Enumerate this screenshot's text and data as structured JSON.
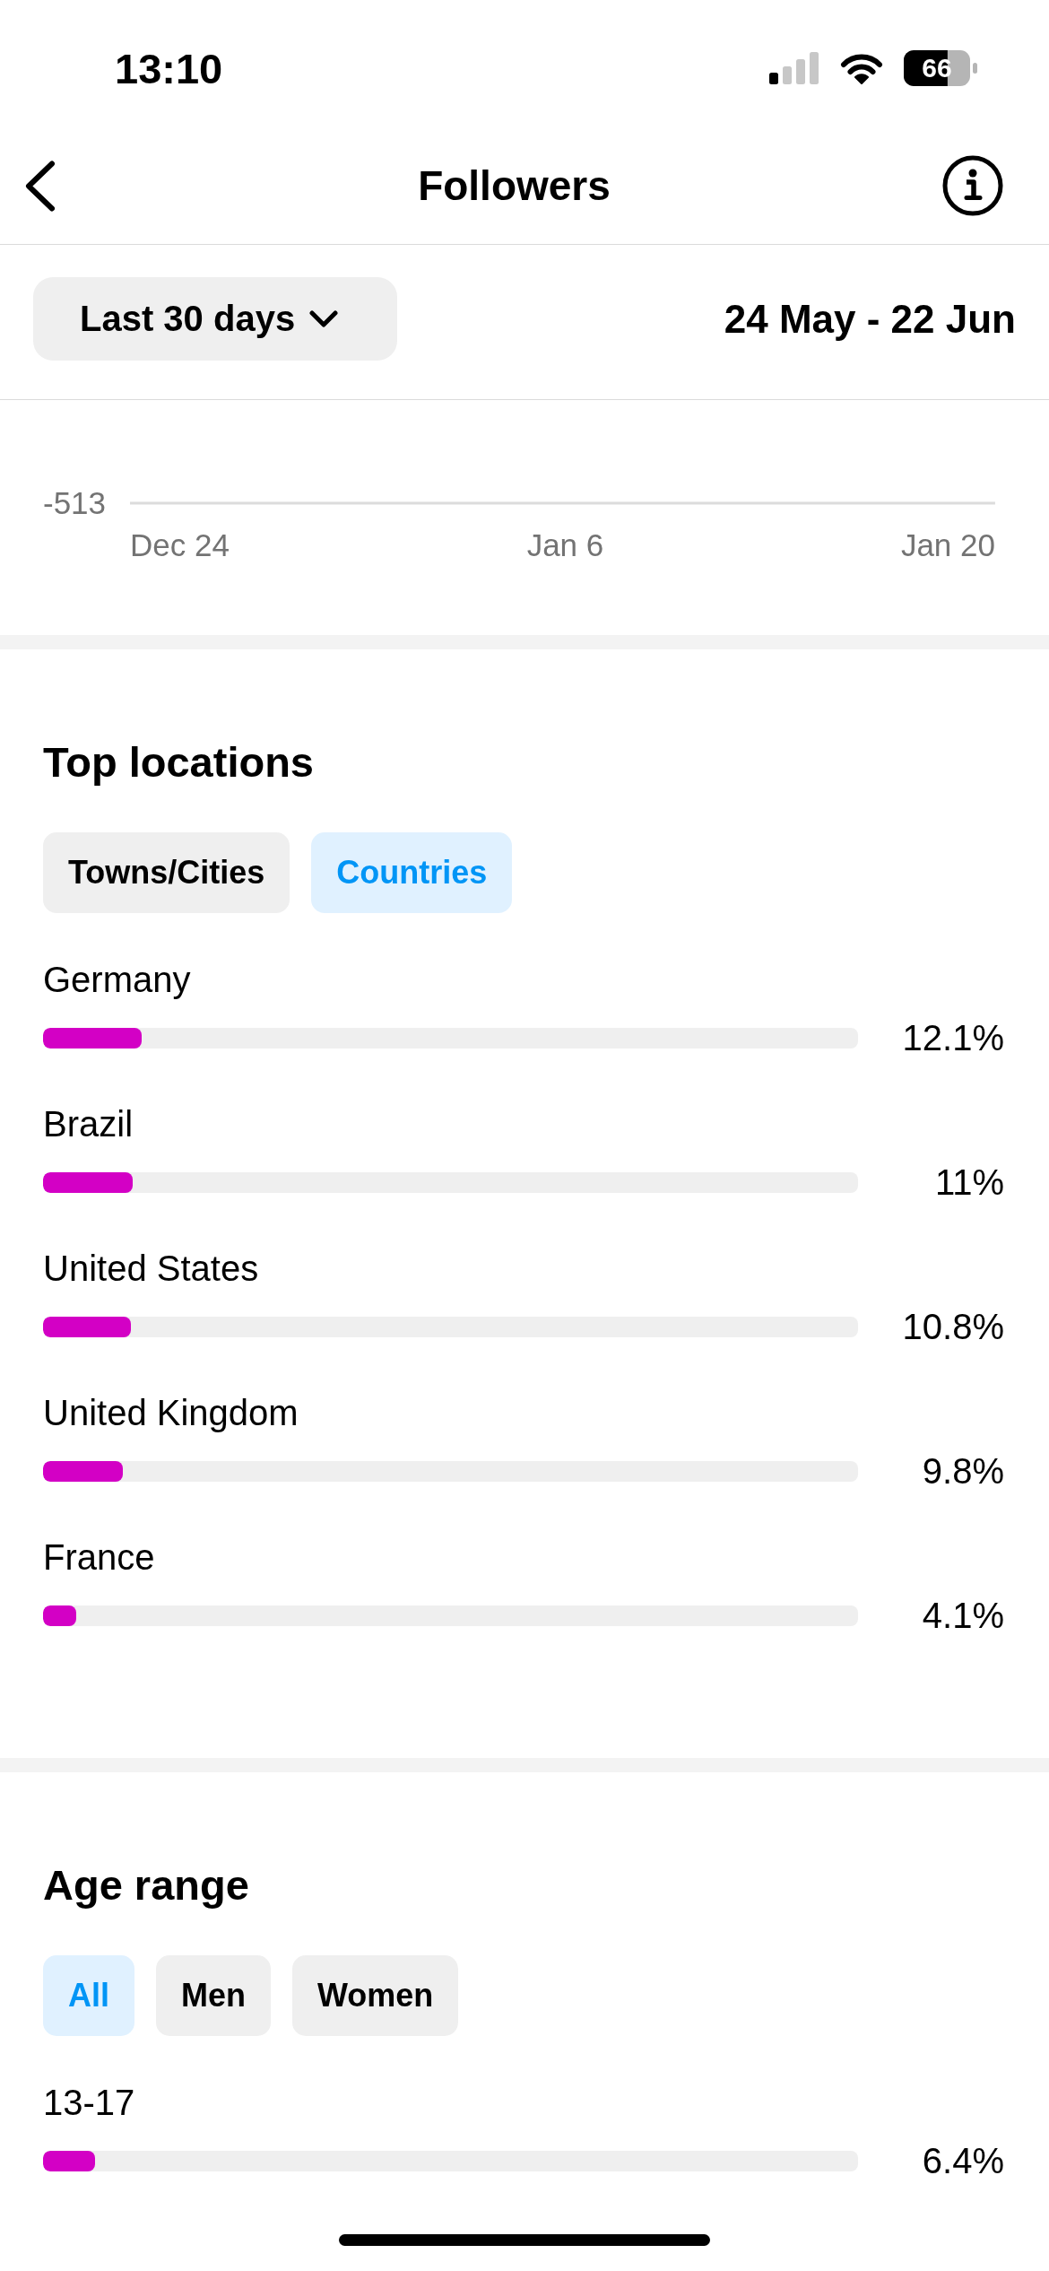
{
  "status_bar": {
    "time": "13:10",
    "battery": "66"
  },
  "header": {
    "title": "Followers"
  },
  "date_filter": {
    "period": "Last 30 days",
    "range": "24 May - 22 Jun"
  },
  "growth_chart": {
    "y_label": "-513",
    "x_labels": [
      "Dec 24",
      "Jan 6",
      "Jan 20"
    ]
  },
  "top_locations": {
    "title": "Top locations",
    "filters": [
      {
        "label": "Towns/Cities",
        "selected": false
      },
      {
        "label": "Countries",
        "selected": true
      }
    ],
    "rows": [
      {
        "name": "Germany",
        "level": 0.121,
        "reading": "12.1%"
      },
      {
        "name": "Brazil",
        "level": 0.11,
        "reading": "11%"
      },
      {
        "name": "United States",
        "level": 0.108,
        "reading": "10.8%"
      },
      {
        "name": "United Kingdom",
        "level": 0.098,
        "reading": "9.8%"
      },
      {
        "name": "France",
        "level": 0.041,
        "reading": "4.1%"
      }
    ]
  },
  "age_range": {
    "title": "Age range",
    "filters": [
      {
        "label": "All",
        "selected": true
      },
      {
        "label": "Men",
        "selected": false
      },
      {
        "label": "Women",
        "selected": false
      }
    ],
    "rows": [
      {
        "name": "13-17",
        "level": 0.064,
        "reading": "6.4%"
      }
    ]
  }
}
